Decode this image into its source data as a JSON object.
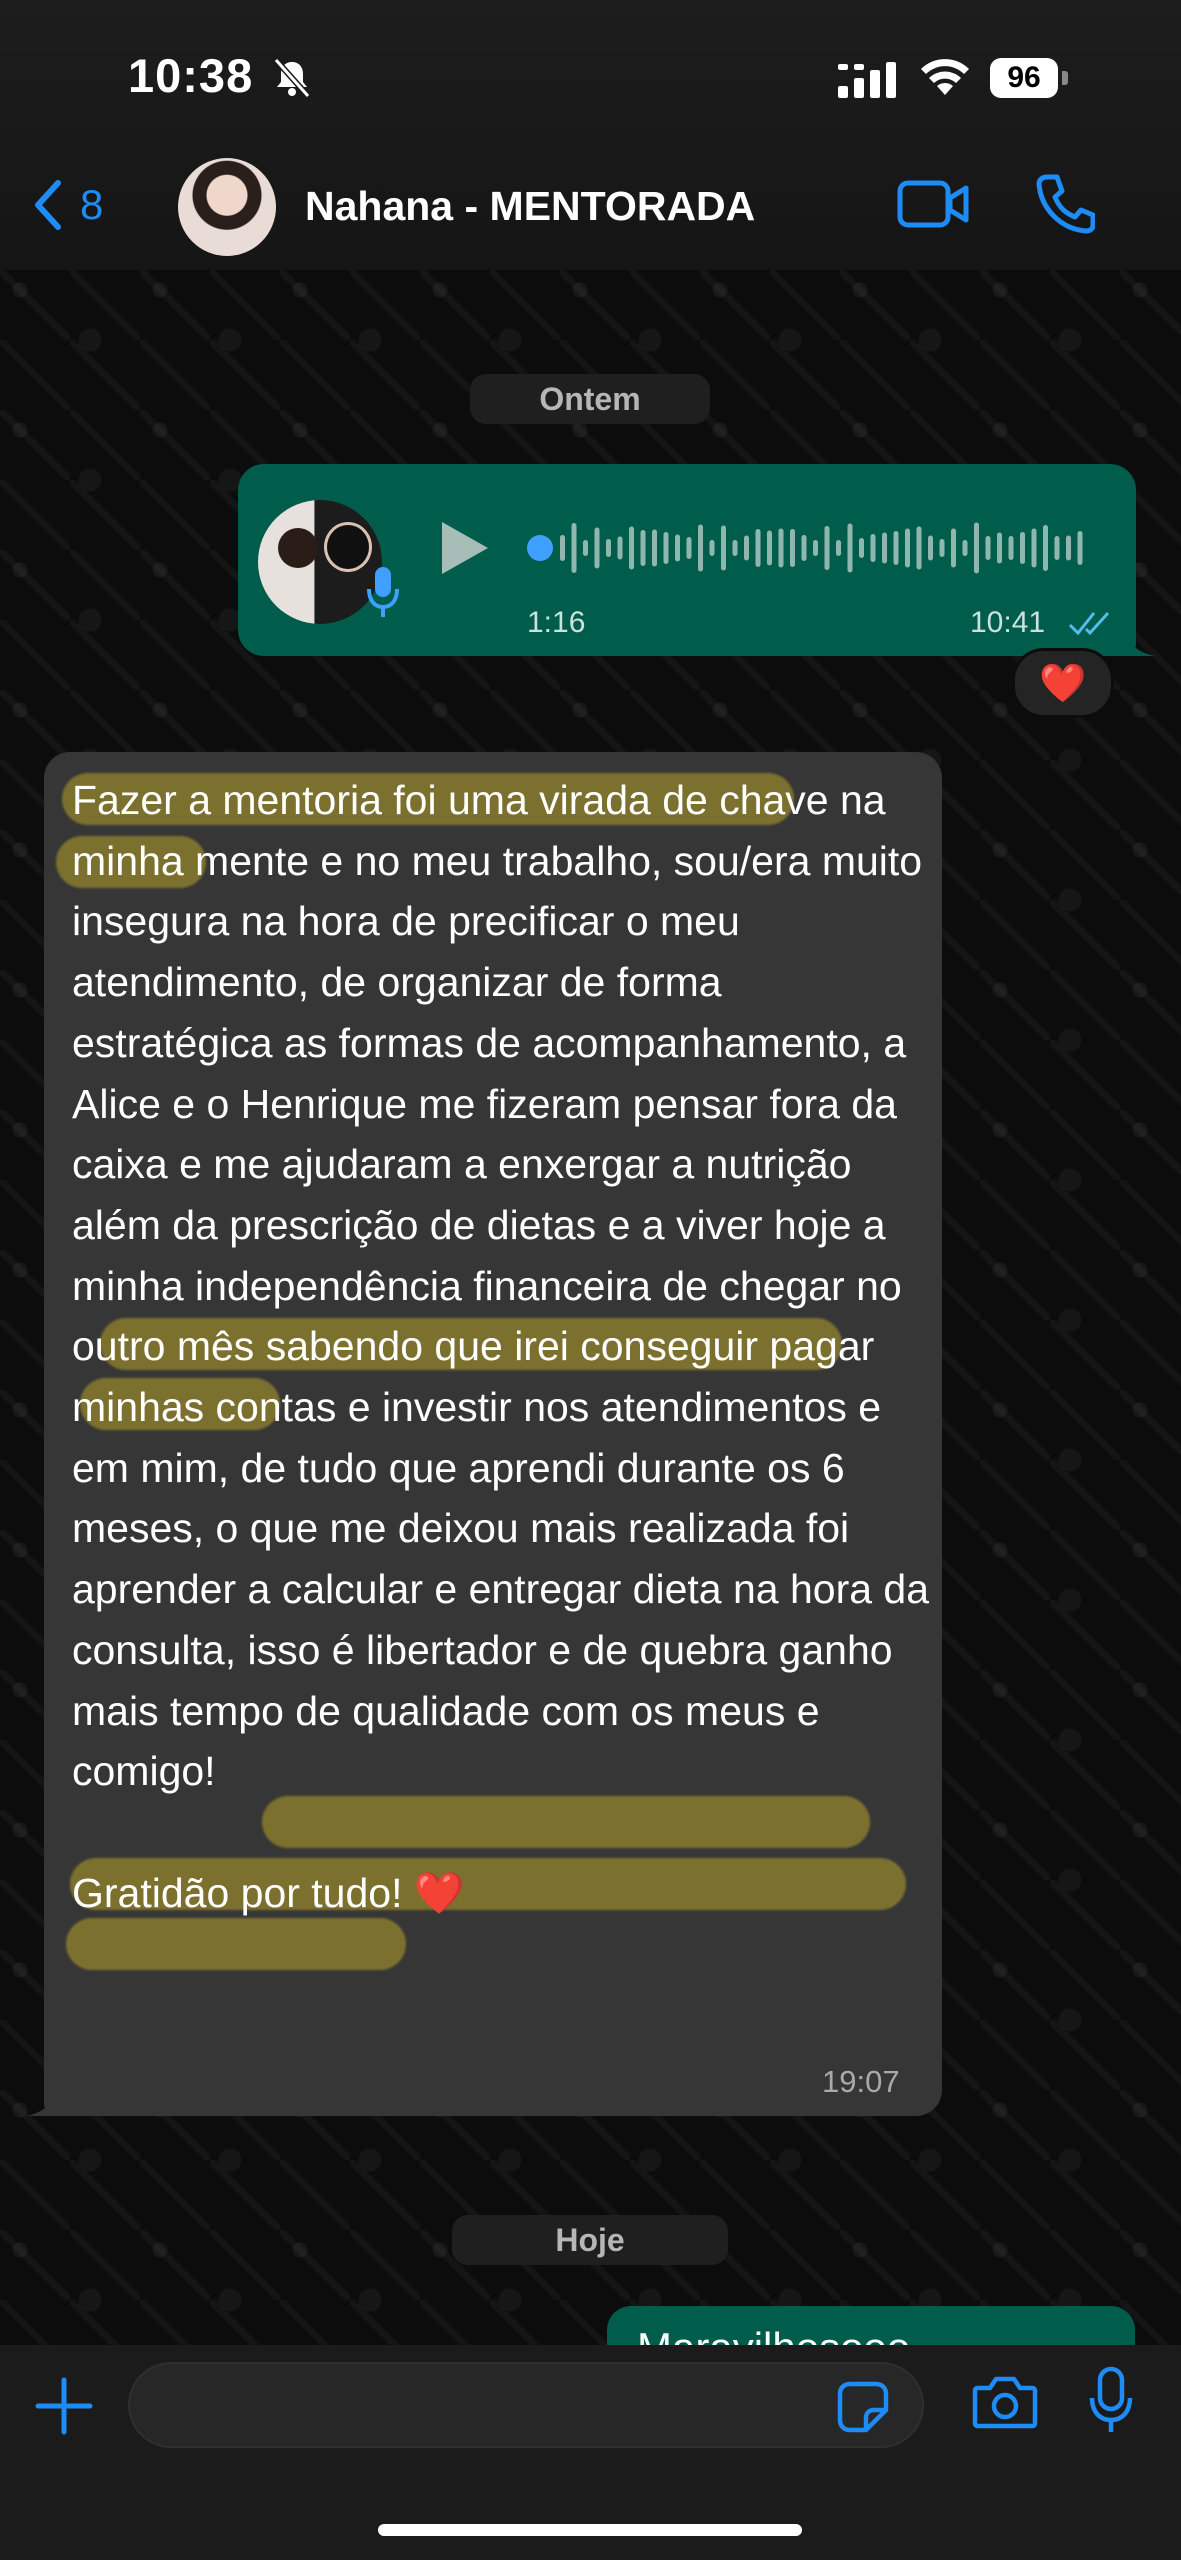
{
  "status_bar": {
    "time": "10:38",
    "battery": "96"
  },
  "header": {
    "back_count": "8",
    "contact_name": "Nahana - MENTORADA"
  },
  "chat": {
    "date_yesterday": "Ontem",
    "date_today": "Hoje",
    "voice_message": {
      "duration": "1:16",
      "time": "10:41",
      "reaction": "❤️"
    },
    "text_message": {
      "body": "Fazer a mentoria foi uma virada de chave na minha mente e no meu trabalho, sou/era muito insegura na hora de precificar o meu atendimento, de organizar de forma estratégica as formas de acompanhamento, a Alice e o Henrique me fizeram pensar fora da caixa e me ajudaram a enxergar a nutrição além da prescrição de dietas e a viver hoje a minha independência financeira de chegar no outro mês sabendo que irei conseguir pagar minhas contas e investir nos atendimentos e em mim, de tudo que aprendi durante os 6 meses, o que me deixou mais realizada foi aprender a calcular e entregar dieta na hora da consulta, isso é libertador e de quebra ganho mais tempo de qualidade com os meus e comigo!",
      "closing": "Gratidão por tudo! ",
      "closing_emoji": "❤️",
      "time": "19:07"
    },
    "next_message_partial": "Maravilhosooo"
  },
  "icons": {
    "back": "chevron-left-icon",
    "mute": "bell-slash-icon",
    "video": "video-camera-icon",
    "phone": "phone-icon",
    "play": "play-icon",
    "mic": "microphone-icon",
    "ticks": "double-check-icon",
    "attach": "plus-icon",
    "sticker": "sticker-icon",
    "camera": "camera-icon"
  },
  "colors": {
    "accent": "#1d8cf6",
    "outgoing_bubble": "#005c4b",
    "incoming_bubble": "#363636",
    "highlight": "#d2b928"
  }
}
